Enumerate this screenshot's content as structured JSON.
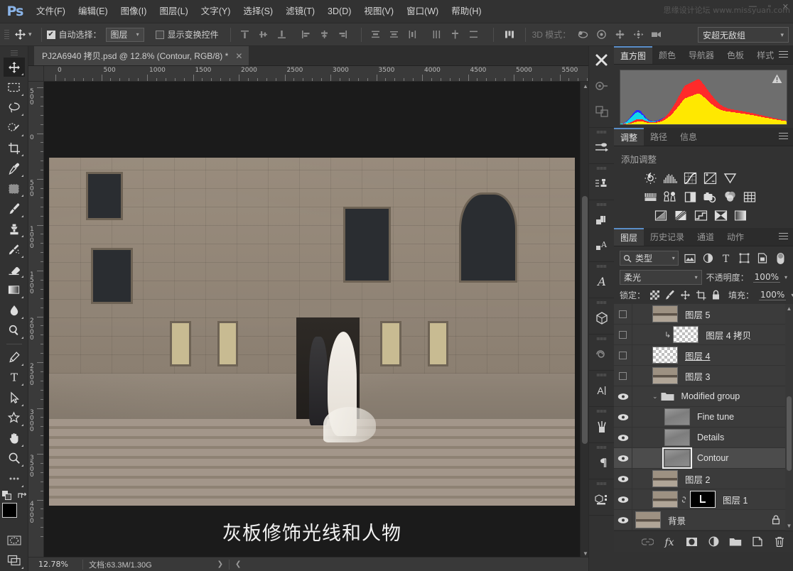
{
  "app": {
    "logo": "Ps"
  },
  "menubar": {
    "items": [
      {
        "label": "文件(F)"
      },
      {
        "label": "编辑(E)"
      },
      {
        "label": "图像(I)"
      },
      {
        "label": "图层(L)"
      },
      {
        "label": "文字(Y)"
      },
      {
        "label": "选择(S)"
      },
      {
        "label": "滤镜(T)"
      },
      {
        "label": "3D(D)"
      },
      {
        "label": "视图(V)"
      },
      {
        "label": "窗口(W)"
      },
      {
        "label": "帮助(H)"
      }
    ],
    "watermark": "思缘设计论坛 www.missyuan.com"
  },
  "options_bar": {
    "tool_icon": "move-tool-icon",
    "auto_select_checked": true,
    "auto_select_label": "自动选择：",
    "auto_select_value": "图层",
    "show_transform_checked": false,
    "show_transform_label": "显示变换控件",
    "mode_3d_label": "3D 模式：",
    "workspace_preset": "安超无敌组"
  },
  "document": {
    "tab_title": "PJ2A6940 拷贝.psd @ 12.8% (Contour, RGB/8) *",
    "close_glyph": "✕",
    "caption_text": "灰板修饰光线和人物",
    "ruler_h_labels": [
      "0",
      "500",
      "1000",
      "1500",
      "2000",
      "2500",
      "3000",
      "3500",
      "4000",
      "4500",
      "5000",
      "5500"
    ],
    "ruler_v_labels": [
      "500",
      "0",
      "500",
      "1000",
      "1500",
      "2000",
      "2500",
      "3000",
      "3500",
      "4000"
    ]
  },
  "status_bar": {
    "zoom": "12.78%",
    "doc_info": "文档:63.3M/1.30G",
    "arrow_right": "❯",
    "arrow_left": "❮"
  },
  "tools": [
    {
      "name": "move-tool",
      "selected": true
    },
    {
      "name": "rectangular-marquee-tool",
      "selected": false
    },
    {
      "name": "lasso-tool",
      "selected": false
    },
    {
      "name": "quick-selection-tool",
      "selected": false
    },
    {
      "name": "crop-tool",
      "selected": false
    },
    {
      "name": "eyedropper-tool",
      "selected": false
    },
    {
      "name": "patch-tool",
      "selected": false
    },
    {
      "name": "brush-tool",
      "selected": false
    },
    {
      "name": "clone-stamp-tool",
      "selected": false
    },
    {
      "name": "history-brush-tool",
      "selected": false
    },
    {
      "name": "eraser-tool",
      "selected": false
    },
    {
      "name": "gradient-tool",
      "selected": false
    },
    {
      "name": "blur-tool",
      "selected": false
    },
    {
      "name": "dodge-tool",
      "selected": false
    },
    {
      "name": "pen-tool",
      "selected": false
    },
    {
      "name": "horizontal-type-tool",
      "selected": false
    },
    {
      "name": "path-selection-tool",
      "selected": false
    },
    {
      "name": "custom-shape-tool",
      "selected": false
    },
    {
      "name": "hand-tool",
      "selected": false
    },
    {
      "name": "zoom-tool",
      "selected": false
    },
    {
      "name": "edit-toolbar-tool",
      "selected": false
    }
  ],
  "right_rail": [
    {
      "name": "healing-rail-icon",
      "dim": false
    },
    {
      "name": "clone-source-rail-icon",
      "dim": true
    },
    {
      "name": "path-rail-icon",
      "dim": true
    },
    {
      "name": "brush-settings-rail-icon",
      "dim": false
    },
    {
      "name": "tool-presets-rail-icon",
      "dim": false
    },
    {
      "name": "layer-comps-rail-icon",
      "dim": false
    },
    {
      "name": "notes-rail-icon",
      "dim": false
    },
    {
      "name": "glyphs-rail-icon",
      "dim": false
    },
    {
      "name": "3d-rail-icon",
      "dim": false
    },
    {
      "name": "properties-rail-icon",
      "dim": true
    },
    {
      "name": "character-rail-icon",
      "dim": false
    },
    {
      "name": "brush-presets-rail-icon",
      "dim": false
    },
    {
      "name": "paragraph-rail-icon",
      "dim": false
    },
    {
      "name": "measurement-rail-icon",
      "dim": false
    }
  ],
  "histogram_panel": {
    "tabs": [
      {
        "label": "直方图",
        "active": true
      },
      {
        "label": "颜色",
        "active": false
      },
      {
        "label": "导航器",
        "active": false
      },
      {
        "label": "色板",
        "active": false
      },
      {
        "label": "样式",
        "active": false
      }
    ],
    "warning_icon": "cached-data-warning-icon"
  },
  "adjustments_panel": {
    "tabs": [
      {
        "label": "调整",
        "active": true
      },
      {
        "label": "路径",
        "active": false
      },
      {
        "label": "信息",
        "active": false
      }
    ],
    "title": "添加调整",
    "icons": [
      {
        "name": "brightness-contrast-icon"
      },
      {
        "name": "levels-icon"
      },
      {
        "name": "curves-icon"
      },
      {
        "name": "exposure-icon"
      },
      {
        "name": "vibrance-icon"
      },
      {
        "name": "hue-saturation-icon"
      },
      {
        "name": "color-balance-icon"
      },
      {
        "name": "black-white-icon"
      },
      {
        "name": "photo-filter-icon"
      },
      {
        "name": "channel-mixer-icon"
      },
      {
        "name": "color-lookup-icon"
      },
      {
        "name": "invert-icon"
      },
      {
        "name": "posterize-icon"
      },
      {
        "name": "threshold-icon"
      },
      {
        "name": "selective-color-icon"
      },
      {
        "name": "gradient-map-icon"
      }
    ]
  },
  "layers_panel": {
    "tabs": [
      {
        "label": "图层",
        "active": true
      },
      {
        "label": "历史记录",
        "active": false
      },
      {
        "label": "通道",
        "active": false
      },
      {
        "label": "动作",
        "active": false
      }
    ],
    "filter_label": "类型",
    "filter_icons": [
      {
        "name": "filter-pixel-icon"
      },
      {
        "name": "filter-adjustment-icon"
      },
      {
        "name": "filter-type-icon"
      },
      {
        "name": "filter-shape-icon"
      },
      {
        "name": "filter-smart-object-icon"
      }
    ],
    "filter_toggle": "filter-enable-toggle",
    "blend_mode": "柔光",
    "opacity_label": "不透明度：",
    "opacity_value": "100%",
    "lock_label": "锁定：",
    "lock_icons": [
      {
        "name": "lock-transparency-icon"
      },
      {
        "name": "lock-image-icon"
      },
      {
        "name": "lock-position-icon"
      },
      {
        "name": "lock-artboard-icon"
      },
      {
        "name": "lock-all-icon"
      }
    ],
    "fill_label": "填充：",
    "fill_value": "100%",
    "layers": [
      {
        "name": "图层 5",
        "visible": false,
        "thumb": "image",
        "selected": false,
        "indent": 1,
        "clipped": false,
        "underline": false
      },
      {
        "name": "图层 4 拷贝",
        "visible": false,
        "thumb": "checker",
        "selected": false,
        "indent": 2,
        "clipped": true,
        "underline": false
      },
      {
        "name": "图层 4",
        "visible": false,
        "thumb": "checker",
        "selected": false,
        "indent": 1,
        "clipped": false,
        "underline": true
      },
      {
        "name": "图层 3",
        "visible": false,
        "thumb": "image",
        "selected": false,
        "indent": 1,
        "clipped": false,
        "underline": false
      },
      {
        "name": "Modified group",
        "visible": true,
        "thumb": "folder",
        "selected": false,
        "indent": 1,
        "clipped": false,
        "underline": false
      },
      {
        "name": "Fine tune",
        "visible": true,
        "thumb": "gray",
        "selected": false,
        "indent": 2,
        "clipped": false,
        "underline": false
      },
      {
        "name": "Details",
        "visible": true,
        "thumb": "gray",
        "selected": false,
        "indent": 2,
        "clipped": false,
        "underline": false
      },
      {
        "name": "Contour",
        "visible": true,
        "thumb": "gray",
        "selected": true,
        "indent": 2,
        "clipped": false,
        "underline": false
      },
      {
        "name": "图层 2",
        "visible": true,
        "thumb": "image",
        "selected": false,
        "indent": 1,
        "clipped": false,
        "underline": false
      },
      {
        "name": "图层 1",
        "visible": true,
        "thumb": "image-mask",
        "selected": false,
        "indent": 1,
        "clipped": false,
        "underline": false
      },
      {
        "name": "背景",
        "visible": true,
        "thumb": "image",
        "selected": false,
        "indent": 0,
        "clipped": false,
        "underline": false,
        "locked": true
      }
    ],
    "footer_icons": [
      {
        "name": "link-layers-icon",
        "dim": true
      },
      {
        "name": "layer-style-fx-icon",
        "dim": false
      },
      {
        "name": "add-layer-mask-icon",
        "dim": false
      },
      {
        "name": "new-adjustment-layer-icon",
        "dim": false
      },
      {
        "name": "new-group-icon",
        "dim": false
      },
      {
        "name": "new-layer-icon",
        "dim": false
      },
      {
        "name": "delete-layer-icon",
        "dim": false
      }
    ]
  },
  "colors": {
    "accent": "#5a8ec9",
    "panel_bg": "#323232",
    "list_bg": "#3b3b3b",
    "selected_layer": "#4c4c4c",
    "foreground_swatch": "#000000",
    "background_swatch": "#ffffff"
  }
}
